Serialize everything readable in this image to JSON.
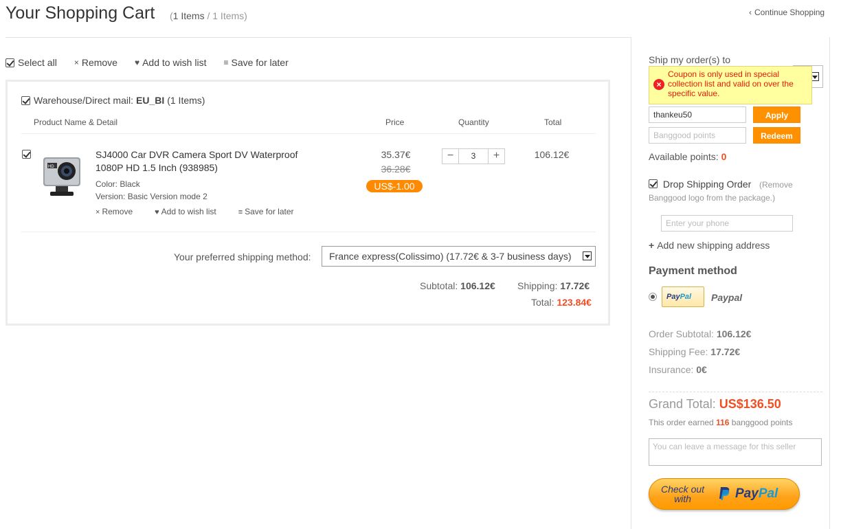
{
  "header": {
    "title": "Your Shopping Cart",
    "count_current": "1 Items",
    "count_total": "1 Items",
    "continue_label": "Continue Shopping"
  },
  "toolbar": {
    "select_all": "Select all",
    "remove": "Remove",
    "wishlist": "Add to wish list",
    "save_later": "Save for later"
  },
  "cart": {
    "warehouse_label": "Warehouse/Direct mail:",
    "warehouse_code": "EU_BI",
    "warehouse_count": "(1 Items)",
    "columns": {
      "product": "Product Name & Detail",
      "price": "Price",
      "quantity": "Quantity",
      "total": "Total"
    },
    "item": {
      "name": "SJ4000 Car DVR Camera Sport DV Waterproof 1080P HD 1.5 Inch (938985)",
      "color": "Color: Black",
      "version": "Version: Basic Version mode 2",
      "remove": "Remove",
      "wishlist": "Add to wish list",
      "save_later": "Save for later",
      "price": "35.37€",
      "old_price": "36.28€",
      "discount": "US$-1.00",
      "quantity": "3",
      "total": "106.12€"
    },
    "shipping_label": "Your preferred shipping method:",
    "shipping_value": "France express(Colissimo) (17.72€ & 3-7 business days)",
    "subtotal_label": "Subtotal:",
    "subtotal_value": "106.12€",
    "shipping_fee_label": "Shipping:",
    "shipping_fee_value": "17.72€",
    "total_label": "Total:",
    "total_value": "123.84€"
  },
  "sidebar": {
    "ship_to": "Ship my order(s) to",
    "coupon_error": "Coupon is only used in special collection list and valid on over the specific value.",
    "coupon_value": "thankeu50",
    "apply": "Apply",
    "points_placeholder": "Banggood points",
    "redeem": "Redeem",
    "available_label": "Available points:",
    "available_value": "0",
    "drop_shipping": "Drop Shipping Order",
    "drop_note": "(Remove Banggood logo from the package.)",
    "phone_placeholder": "Enter your phone",
    "add_address": "Add new shipping address",
    "payment_title": "Payment method",
    "paypal_label": "Paypal",
    "order_subtotal_label": "Order Subtotal:",
    "order_subtotal_value": "106.12€",
    "shipping_fee_label": "Shipping Fee:",
    "shipping_fee_value": "17.72€",
    "insurance_label": "Insurance:",
    "insurance_value": "0€",
    "grand_total_label": "Grand Total:",
    "grand_total_value": "US$136.50",
    "earned_prefix": "This order earned",
    "earned_points": "116",
    "earned_suffix": "banggood points",
    "message_placeholder": "You can leave a message for this seller",
    "checkout_line1": "Check out",
    "checkout_line2": "with",
    "paypal_word_a": "Pay",
    "paypal_word_b": "Pal"
  },
  "icons": {
    "chevron_left": "chevron-left-icon",
    "remove": "close-icon",
    "wishlist": "heart-icon",
    "save_later": "list-icon",
    "error": "error-icon",
    "plus": "plus-icon"
  },
  "colors": {
    "accent_orange": "#ff9100",
    "price_red": "#f04e23",
    "paypal_navy": "#253b80",
    "paypal_blue": "#179bd7"
  }
}
